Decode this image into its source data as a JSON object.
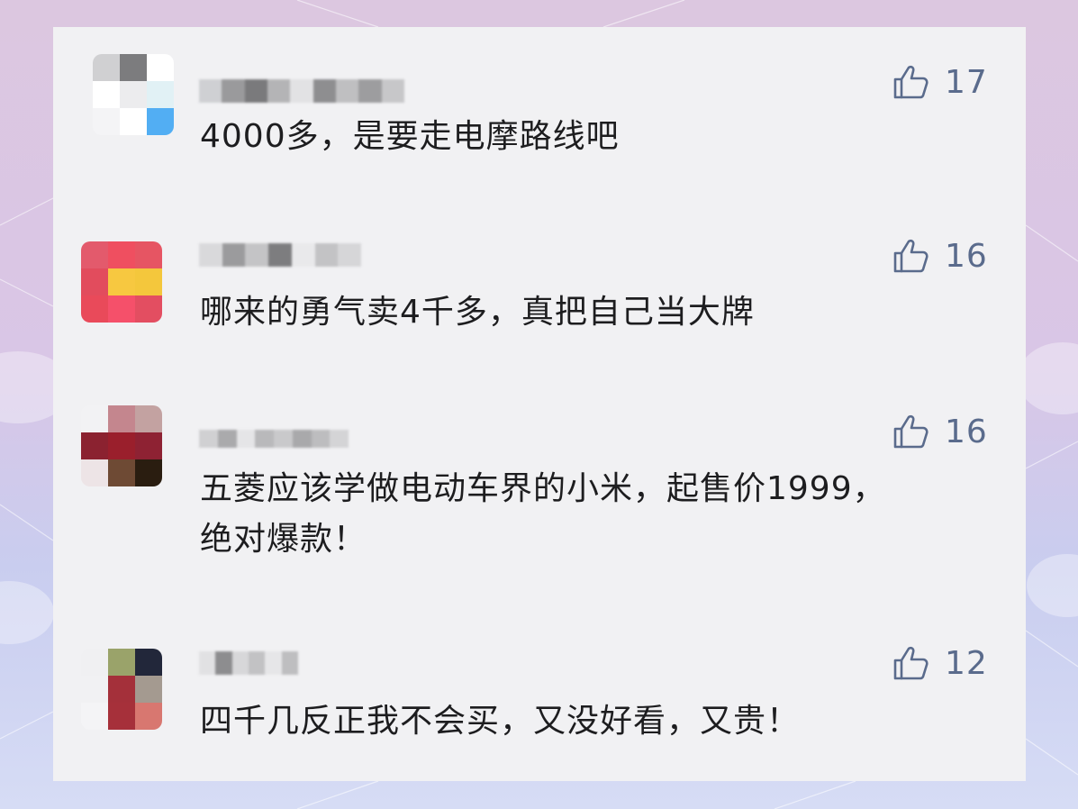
{
  "comments": [
    {
      "avatar_colors": [
        "#d0d0d2",
        "#7c7c7e",
        "#ffffff",
        "#ffffff",
        "#ececee",
        "#e1f1f5",
        "#f4f4f6",
        "#ffffff",
        "#52aef3"
      ],
      "username_colors": [
        "#cfd0d3",
        "#9a9a9c",
        "#7a7a7c",
        "#b4b4b6",
        "#e2e2e4",
        "#8e8e90",
        "#bfbfc1",
        "#9d9d9f",
        "#c7c7c9"
      ],
      "text": "4000多，是要走电摩路线吧",
      "likes": "17"
    },
    {
      "avatar_colors": [
        "#e35a6c",
        "#ef4f60",
        "#e65563",
        "#e24c5d",
        "#f7c840",
        "#f4c73c",
        "#e94a5a",
        "#f5506a",
        "#e34e61"
      ],
      "username_colors": [
        "#d9d9db",
        "#9b9b9d",
        "#c4c4c6",
        "#7d7d7f",
        "#e9e9eb",
        "#c3c3c5",
        "#d6d6d8"
      ],
      "text": "哪来的勇气卖4千多，真把自己当大牌",
      "likes": "16"
    },
    {
      "avatar_colors": [
        "#f2f2f4",
        "#c4868e",
        "#c3a2a1",
        "#8b2230",
        "#9a1f2c",
        "#8e2233",
        "#ede4e6",
        "#6e4a34",
        "#2a1d10"
      ],
      "username_colors": [
        "#d0d0d2",
        "#aaaaac",
        "#e5e5e7",
        "#b9b9bb",
        "#c9c9cb",
        "#a9a9ab",
        "#bdbdbf",
        "#d4d4d6"
      ],
      "text": "五菱应该学做电动车界的小米，起售价1999，绝对爆款！",
      "likes": "16"
    },
    {
      "avatar_colors": [
        "#f0f0f2",
        "#9aa36a",
        "#22273a",
        "#f1f1f3",
        "#a4303a",
        "#a49a90",
        "#f4f4f6",
        "#a6303a",
        "#d87770"
      ],
      "username_colors": [
        "#e1e1e3",
        "#8d8d8f",
        "#d7d7d9",
        "#c2c2c4",
        "#e6e6e8",
        "#bebec0"
      ],
      "text": "四千几反正我不会买，又没好看，又贵！",
      "likes": "12"
    }
  ]
}
